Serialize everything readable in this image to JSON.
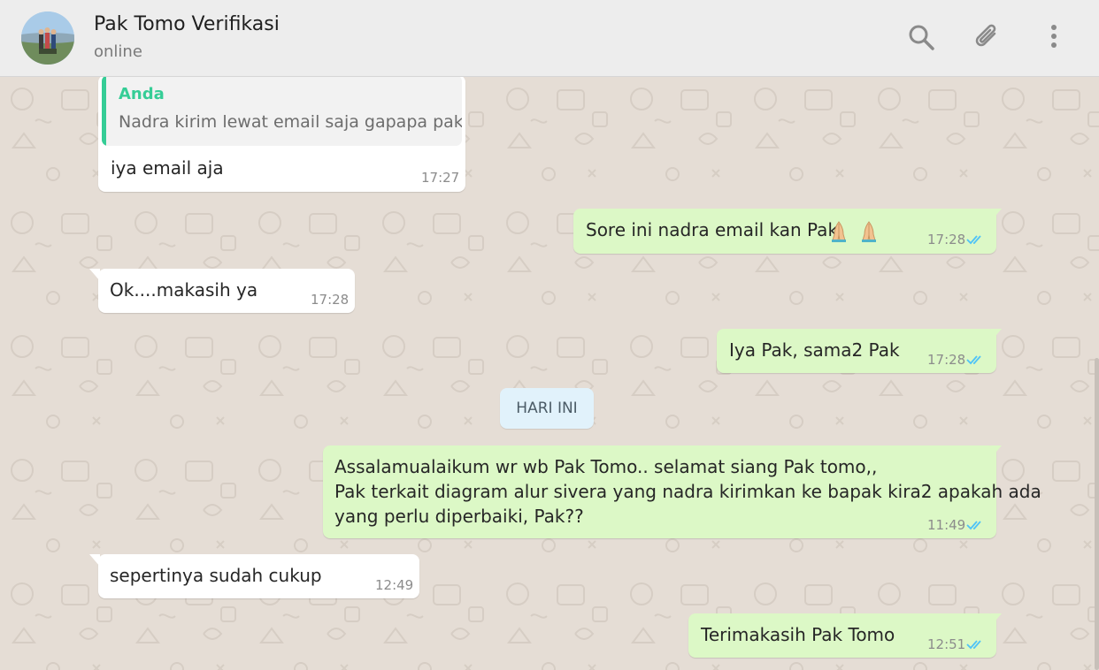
{
  "header": {
    "contact_name": "Pak Tomo Verifikasi",
    "status": "online",
    "icons": [
      "search-icon",
      "attach-icon",
      "more-menu-icon"
    ]
  },
  "colors": {
    "incoming_bubble": "#ffffff",
    "outgoing_bubble": "#dcf8c6",
    "quote_accent": "#35cd96",
    "read_ticks": "#4fc3f7",
    "date_chip": "#e1f2fb"
  },
  "messages": [
    {
      "direction": "in",
      "quote": {
        "author": "Anda",
        "text": "Nadra kirim lewat email saja gapapa pak??"
      },
      "text": "iya email aja",
      "time": "17:27"
    },
    {
      "direction": "out",
      "text": "Sore ini nadra email kan Pak",
      "emoji": [
        "folded-hands-emoji",
        "folded-hands-emoji"
      ],
      "time": "17:28",
      "status": "read"
    },
    {
      "direction": "in",
      "text": "Ok....makasih ya",
      "time": "17:28"
    },
    {
      "direction": "out",
      "text": "Iya Pak, sama2 Pak",
      "time": "17:28",
      "status": "read"
    },
    {
      "direction": "out",
      "lines": [
        "Assalamualaikum wr wb Pak Tomo.. selamat siang Pak tomo,,",
        "Pak terkait diagram alur sivera yang nadra kirimkan ke bapak kira2 apakah ada",
        "yang perlu diperbaiki, Pak??"
      ],
      "time": "11:49",
      "status": "read"
    },
    {
      "direction": "in",
      "text": "sepertinya sudah cukup",
      "time": "12:49"
    },
    {
      "direction": "out",
      "text": "Terimakasih Pak Tomo",
      "time": "12:51",
      "status": "read"
    }
  ],
  "date_separator": "HARI INI"
}
